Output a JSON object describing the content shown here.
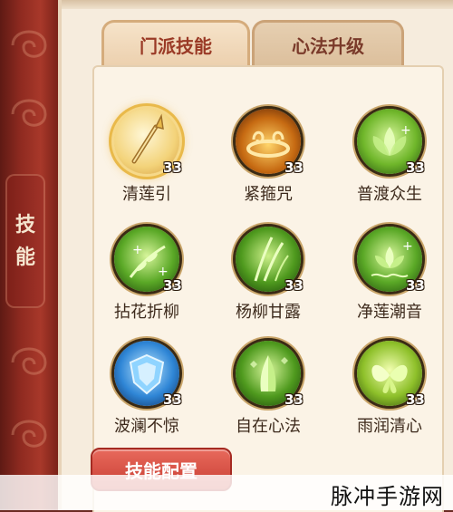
{
  "side_tab": {
    "char1": "技",
    "char2": "能"
  },
  "tabs": [
    {
      "label": "门派技能",
      "active": true
    },
    {
      "label": "心法升级",
      "active": false
    }
  ],
  "skills": [
    {
      "name": "清莲引",
      "level": "33",
      "icon": "golden-staff-icon",
      "selected": true
    },
    {
      "name": "紧箍咒",
      "level": "33",
      "icon": "golden-headband-icon",
      "selected": false
    },
    {
      "name": "普渡众生",
      "level": "33",
      "icon": "lotus-heal-icon",
      "selected": false
    },
    {
      "name": "拈花折柳",
      "level": "33",
      "icon": "willow-heal-icon",
      "selected": false
    },
    {
      "name": "杨柳甘露",
      "level": "33",
      "icon": "bamboo-dew-icon",
      "selected": false
    },
    {
      "name": "净莲潮音",
      "level": "33",
      "icon": "lotus-wave-icon",
      "selected": false
    },
    {
      "name": "波澜不惊",
      "level": "33",
      "icon": "blue-shield-icon",
      "selected": false
    },
    {
      "name": "自在心法",
      "level": "33",
      "icon": "praying-hands-icon",
      "selected": false
    },
    {
      "name": "雨润清心",
      "level": "33",
      "icon": "butterfly-icon",
      "selected": false
    }
  ],
  "config_button": "技能配置",
  "watermark": "脉冲手游网",
  "colors": {
    "accent_red": "#c83e33",
    "parchment": "#f6ecdd",
    "gold": "#e9b94a",
    "heal_green": "#4f9a1e"
  }
}
